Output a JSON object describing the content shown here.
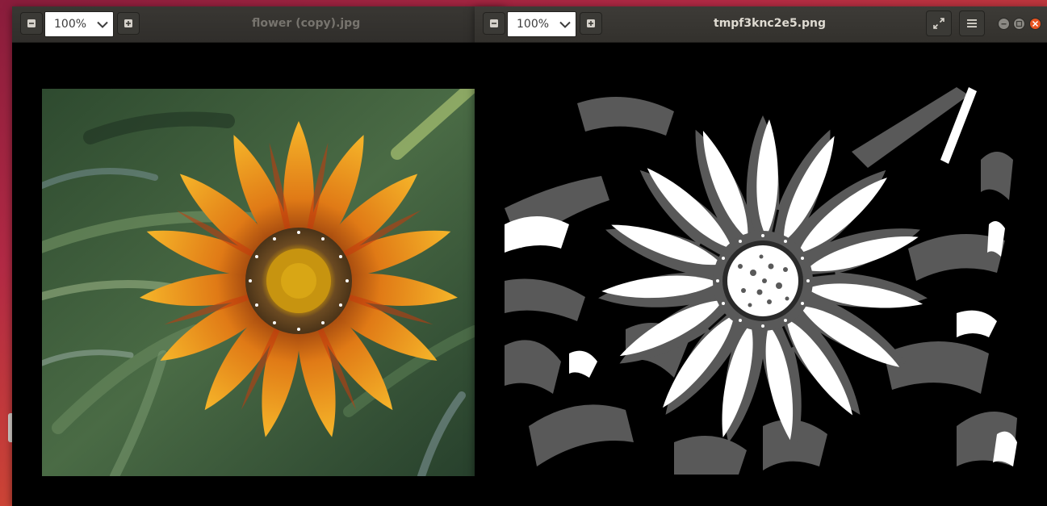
{
  "left_window": {
    "title": "flower (copy).jpg",
    "zoom": {
      "value": "100%"
    },
    "buttons": {
      "zoom_out_icon": "minus-icon",
      "zoom_in_icon": "plus-icon"
    },
    "image": {
      "alt": "Orange gazania flower on green foliage background",
      "colors": {
        "petal_orange": "#f0a020",
        "petal_red": "#d84a10",
        "center": "#c98a10",
        "foliage": "#3b5a34"
      }
    }
  },
  "right_window": {
    "title": "tmpf3knc2e5.png",
    "zoom": {
      "value": "100%"
    },
    "buttons": {
      "zoom_out_icon": "minus-icon",
      "zoom_in_icon": "plus-icon",
      "fullscreen_icon": "fullscreen-icon",
      "menu_icon": "hamburger-menu-icon",
      "minimize_icon": "minimize-icon",
      "maximize_icon": "maximize-icon",
      "close_icon": "close-icon"
    },
    "image": {
      "alt": "Posterized three-level grayscale version of the flower image",
      "colors": {
        "white": "#ffffff",
        "gray": "#595959",
        "black": "#000000"
      }
    }
  },
  "desktop": {
    "background_colors": [
      "#8a1d3c",
      "#d9512f"
    ]
  }
}
